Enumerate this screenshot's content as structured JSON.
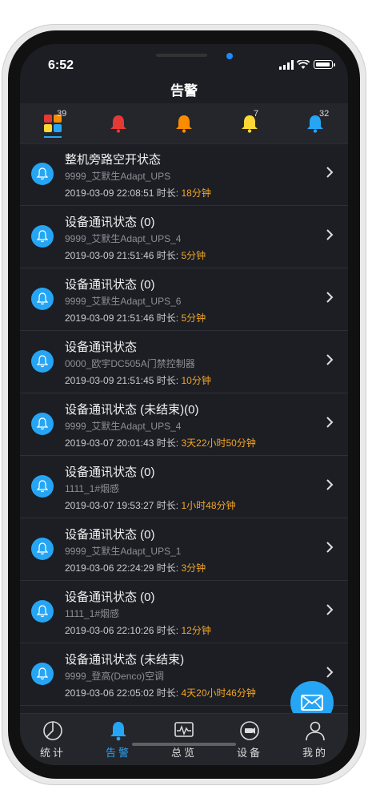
{
  "status": {
    "time": "6:52"
  },
  "header": {
    "title": "告警"
  },
  "filters": [
    {
      "name": "all",
      "count": "39"
    },
    {
      "name": "critical",
      "count": ""
    },
    {
      "name": "major",
      "count": ""
    },
    {
      "name": "minor",
      "count": "7"
    },
    {
      "name": "info",
      "count": "32"
    }
  ],
  "alarms": [
    {
      "title": "整机旁路空开状态",
      "device": "9999_艾默生Adapt_UPS",
      "time": "2019-03-09 22:08:51",
      "dur_label": "时长:",
      "duration": "18分钟"
    },
    {
      "title": "设备通讯状态 (0)",
      "device": "9999_艾默生Adapt_UPS_4",
      "time": "2019-03-09 21:51:46",
      "dur_label": "时长:",
      "duration": "5分钟"
    },
    {
      "title": "设备通讯状态 (0)",
      "device": "9999_艾默生Adapt_UPS_6",
      "time": "2019-03-09 21:51:46",
      "dur_label": "时长:",
      "duration": "5分钟"
    },
    {
      "title": "设备通讯状态",
      "device": "0000_欧宇DC505A门禁控制器",
      "time": "2019-03-09 21:51:45",
      "dur_label": "时长:",
      "duration": "10分钟"
    },
    {
      "title": "设备通讯状态 (未结束)(0)",
      "device": "9999_艾默生Adapt_UPS_4",
      "time": "2019-03-07 20:01:43",
      "dur_label": "时长:",
      "duration": "3天22小时50分钟"
    },
    {
      "title": "设备通讯状态 (0)",
      "device": "1111_1#烟感",
      "time": "2019-03-07 19:53:27",
      "dur_label": "时长:",
      "duration": "1小时48分钟"
    },
    {
      "title": "设备通讯状态 (0)",
      "device": "9999_艾默生Adapt_UPS_1",
      "time": "2019-03-06 22:24:29",
      "dur_label": "时长:",
      "duration": "3分钟"
    },
    {
      "title": "设备通讯状态 (0)",
      "device": "1111_1#烟感",
      "time": "2019-03-06 22:10:26",
      "dur_label": "时长:",
      "duration": "12分钟"
    },
    {
      "title": "设备通讯状态 (未结束)",
      "device": "9999_登高(Denco)空调",
      "time": "2019-03-06 22:05:02",
      "dur_label": "时长:",
      "duration": "4天20小时46分钟"
    }
  ],
  "tabs": [
    {
      "label": "统计",
      "icon": "pie-chart-icon"
    },
    {
      "label": "告警",
      "icon": "bell-icon"
    },
    {
      "label": "总览",
      "icon": "monitor-icon"
    },
    {
      "label": "设备",
      "icon": "camera-icon"
    },
    {
      "label": "我的",
      "icon": "person-icon"
    }
  ],
  "colors": {
    "accent": "#26a5f5",
    "duration": "#f5a623",
    "critical": "#e53935",
    "major": "#fb8c00",
    "minor": "#fdd835",
    "info": "#26a5f5"
  }
}
